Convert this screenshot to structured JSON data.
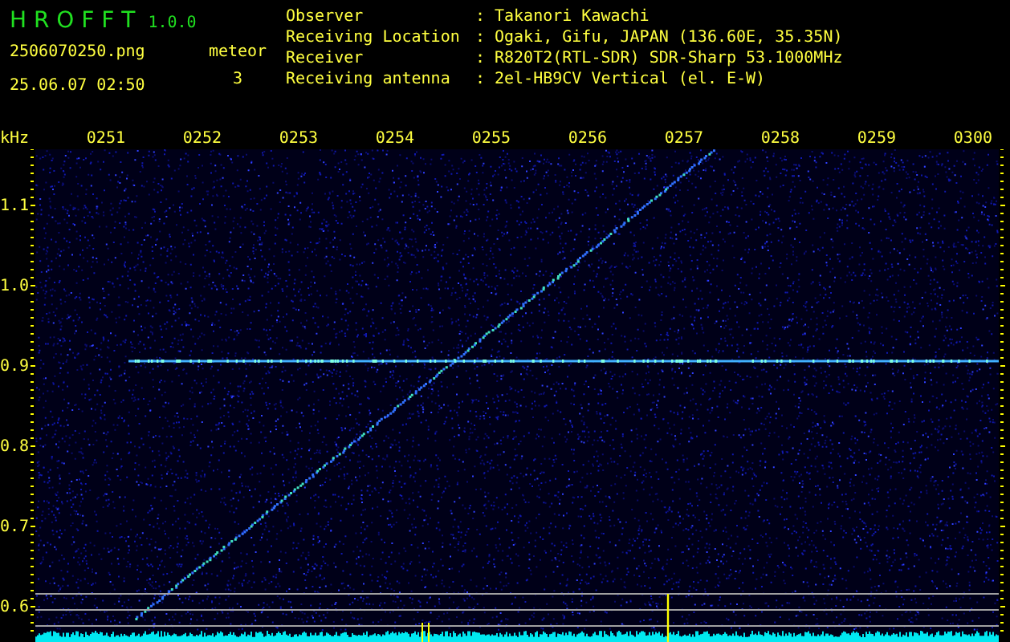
{
  "app": {
    "name": "H R O F F T",
    "version": "1.0.0"
  },
  "file_name": "2506070250.png",
  "timestamp": "25.06.07 02:50",
  "meteor": {
    "label": "meteor",
    "count": "3"
  },
  "station_info": [
    {
      "label": "Observer",
      "separator": ":",
      "value": "Takanori Kawachi"
    },
    {
      "label": "Receiving Location",
      "separator": ":",
      "value": "Ogaki, Gifu, JAPAN (136.60E, 35.35N)"
    },
    {
      "label": "Receiver",
      "separator": ":",
      "value": "R820T2(RTL-SDR) SDR-Sharp 53.1000MHz"
    },
    {
      "label": "Receiving antenna",
      "separator": ":",
      "value": "2el-HB9CV Vertical (el. E-W)"
    }
  ],
  "spectrogram": {
    "y_unit": "kHz",
    "x_labels": [
      "0251",
      "0252",
      "0253",
      "0254",
      "0255",
      "0256",
      "0257",
      "0258",
      "0259",
      "0300"
    ],
    "y_labels": [
      "1.1",
      "1.0",
      "0.9",
      "0.8",
      "0.7",
      "0.6"
    ]
  }
}
